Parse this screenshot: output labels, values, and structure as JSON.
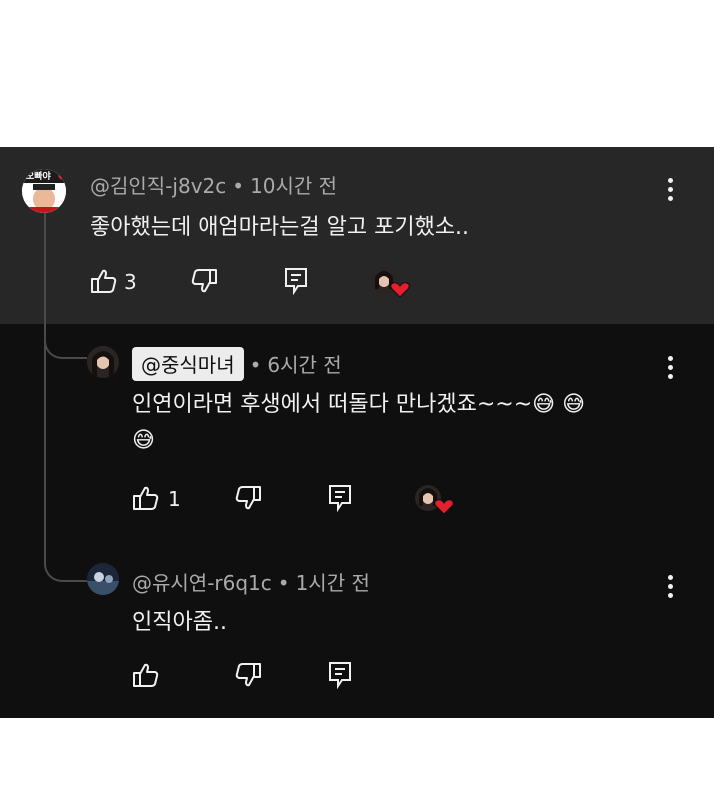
{
  "comments": [
    {
      "handle": "@김인직-j8v2c",
      "time": "10시간 전",
      "text": "좋아했는데 애엄마라는걸 알고 포기했소..",
      "likes": "3",
      "avatar_label": "오빠야"
    },
    {
      "handle": "@중식마녀",
      "time": "6시간 전",
      "text_line1": "인연이라면 후생에서 떠돌다 만나겠죠~~~",
      "likes": "1",
      "emoji": "😅"
    },
    {
      "handle": "@유시연-r6q1c",
      "time": "1시간 전",
      "text": "인직아좀..",
      "likes": ""
    }
  ],
  "separator": "•",
  "icons": [
    "like-icon",
    "dislike-icon",
    "reply-icon",
    "creator-heart-icon",
    "more-options-icon"
  ],
  "colors": {
    "panel_top": "#272727",
    "panel": "#0f0f0f",
    "text": "#f1f1f1",
    "meta": "#aaaaaa",
    "heart": "#e5202e"
  }
}
